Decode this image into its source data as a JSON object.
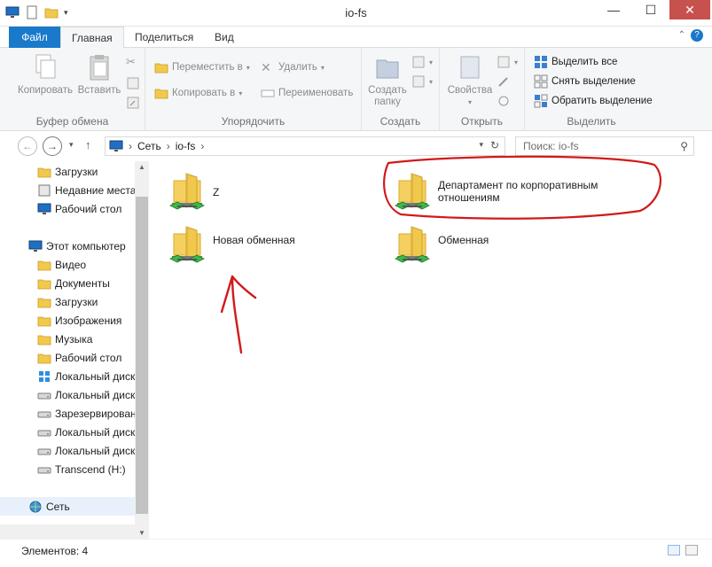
{
  "window": {
    "title": "io-fs",
    "minimize": "—",
    "maximize": "☐",
    "close": "✕"
  },
  "tabs": [
    "Файл",
    "Главная",
    "Поделиться",
    "Вид"
  ],
  "ribbon": {
    "clipboard": {
      "label": "Буфер обмена",
      "copy": "Копировать",
      "paste": "Вставить"
    },
    "organize": {
      "label": "Упорядочить",
      "move_to": "Переместить в",
      "copy_to": "Копировать в",
      "delete": "Удалить",
      "rename": "Переименовать"
    },
    "new": {
      "label": "Создать",
      "new_folder_line1": "Создать",
      "new_folder_line2": "папку"
    },
    "open": {
      "label": "Открыть",
      "properties": "Свойства"
    },
    "select": {
      "label": "Выделить",
      "select_all": "Выделить все",
      "select_none": "Снять выделение",
      "invert": "Обратить выделение"
    }
  },
  "address": {
    "path": [
      "Сеть",
      "io-fs"
    ],
    "search_placeholder": "Поиск: io-fs"
  },
  "nav": {
    "favorites": [
      "Загрузки",
      "Недавние места",
      "Рабочий стол"
    ],
    "this_pc": "Этот компьютер",
    "pc_items": [
      "Видео",
      "Документы",
      "Загрузки",
      "Изображения",
      "Музыка",
      "Рабочий стол",
      "Локальный диск",
      "Локальный диск",
      "Зарезервировано",
      "Локальный диск",
      "Локальный диск",
      "Transcend (H:)"
    ],
    "network": "Сеть"
  },
  "content": {
    "items": [
      {
        "line1": "Z",
        "line2": ""
      },
      {
        "line1": "Департамент по корпоративным",
        "line2": "отношениям"
      },
      {
        "line1": "Новая обменная",
        "line2": ""
      },
      {
        "line1": "Обменная",
        "line2": ""
      }
    ]
  },
  "status": {
    "text": "Элементов: 4"
  },
  "colors": {
    "file_tab": "#1979ca",
    "close_button": "#c7514d",
    "annotation": "#d11a1a",
    "folder": "#f0c94c"
  }
}
